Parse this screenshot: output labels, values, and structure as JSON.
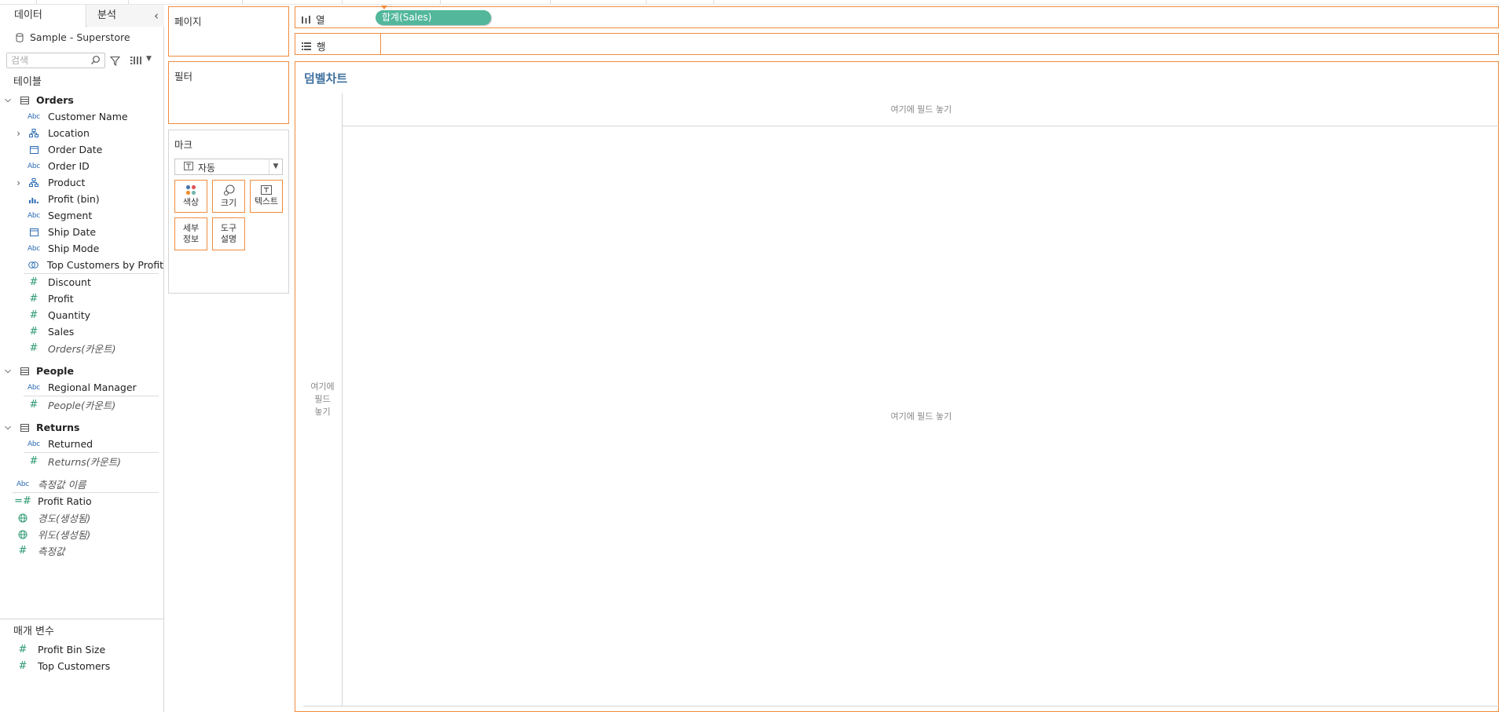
{
  "tabs": {
    "data": "데이터",
    "analysis": "분석"
  },
  "datasource": "Sample - Superstore",
  "search": {
    "placeholder": "검색"
  },
  "tables_label": "테이블",
  "groups": [
    {
      "name": "Orders",
      "fields": [
        {
          "name": "Customer Name",
          "icon": "abc-icon"
        },
        {
          "name": "Location",
          "icon": "hierarchy-icon"
        },
        {
          "name": "Order Date",
          "icon": "calendar-icon"
        },
        {
          "name": "Order ID",
          "icon": "abc-icon"
        },
        {
          "name": "Product",
          "icon": "hierarchy-icon"
        },
        {
          "name": "Profit (bin)",
          "icon": "bin-icon"
        },
        {
          "name": "Segment",
          "icon": "abc-icon"
        },
        {
          "name": "Ship Date",
          "icon": "calendar-icon"
        },
        {
          "name": "Ship Mode",
          "icon": "abc-icon"
        },
        {
          "name": "Top Customers by Profit",
          "icon": "set-icon"
        },
        {
          "name": "Discount",
          "icon": "hash-icon"
        },
        {
          "name": "Profit",
          "icon": "hash-icon"
        },
        {
          "name": "Quantity",
          "icon": "hash-icon"
        },
        {
          "name": "Sales",
          "icon": "hash-icon"
        },
        {
          "name": "Orders(카운트)",
          "icon": "hash-icon"
        }
      ]
    },
    {
      "name": "People",
      "fields": [
        {
          "name": "Regional Manager",
          "icon": "abc-icon"
        },
        {
          "name": "People(카운트)",
          "icon": "hash-icon"
        }
      ]
    },
    {
      "name": "Returns",
      "fields": [
        {
          "name": "Returned",
          "icon": "abc-icon"
        },
        {
          "name": "Returns(카운트)",
          "icon": "hash-icon"
        }
      ]
    }
  ],
  "root_fields": [
    {
      "name": "측정값 이름",
      "icon": "abc-icon"
    },
    {
      "name": "Profit Ratio",
      "icon": "calc-hash-icon"
    },
    {
      "name": "경도(생성됨)",
      "icon": "globe-icon"
    },
    {
      "name": "위도(생성됨)",
      "icon": "globe-icon"
    },
    {
      "name": "측정값",
      "icon": "hash-icon"
    }
  ],
  "params_label": "매개 변수",
  "params": [
    {
      "name": "Profit Bin Size"
    },
    {
      "name": "Top Customers"
    }
  ],
  "cards": {
    "pages": "페이지",
    "filters": "필터",
    "marks": "마크"
  },
  "marks": {
    "type": "자동",
    "buttons": {
      "color": "색상",
      "size": "크기",
      "text": "텍스트",
      "detail": "세부\n정보",
      "tooltip": "도구\n설명"
    }
  },
  "shelves": {
    "columns": "열",
    "rows": "행",
    "pill": "합계(Sales)"
  },
  "view": {
    "title": "덤벨차트",
    "drop_hint": "여기에 필드 놓기",
    "drop_hint_vertical": "여기에\n필드\n놓기"
  },
  "colors": {
    "accent": "#f08c3d",
    "pill": "#52b79b",
    "measure": "#2e9a72",
    "dimension": "#2d6cb5",
    "title": "#3d6f9e"
  }
}
